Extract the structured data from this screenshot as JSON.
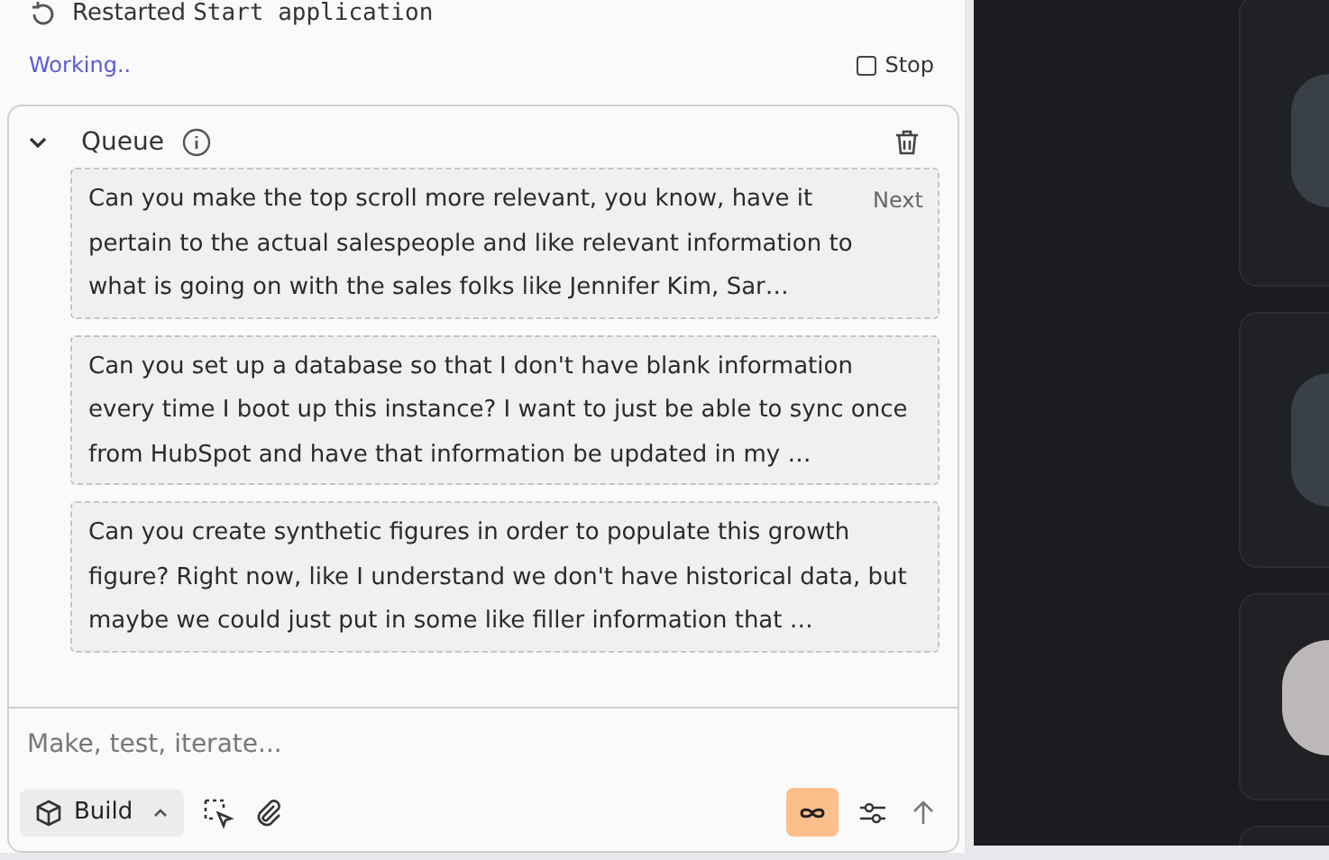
{
  "log_line": {
    "prefix": "Restarted",
    "command": "Start application"
  },
  "status": {
    "text": "Working..",
    "stop_label": "Stop"
  },
  "queue": {
    "title": "Queue",
    "expanded": true,
    "items": [
      {
        "text": "Can you make the top scroll more relevant, you know, have it pertain to the actual salespeople and like relevant information to what is going on with the sales folks like Jennifer Kim, Sar…",
        "badge": "Next"
      },
      {
        "text": "Can you set up a database so that I don't have blank information every time I boot up this instance? I want to just be able to sync once from HubSpot and have that information be updated in my …"
      },
      {
        "text": "Can you create synthetic figures in order to populate this growth figure? Right now, like I understand we don't have historical data, but maybe we could just put in some like filler information that …"
      }
    ]
  },
  "composer": {
    "placeholder": "Make, test, iterate...",
    "mode_label": "Build",
    "infinite_on": true
  },
  "preview_cards": [
    {
      "kind": "photo"
    },
    {
      "kind": "photo"
    },
    {
      "kind": "blank"
    },
    {
      "kind": "empty"
    }
  ]
}
